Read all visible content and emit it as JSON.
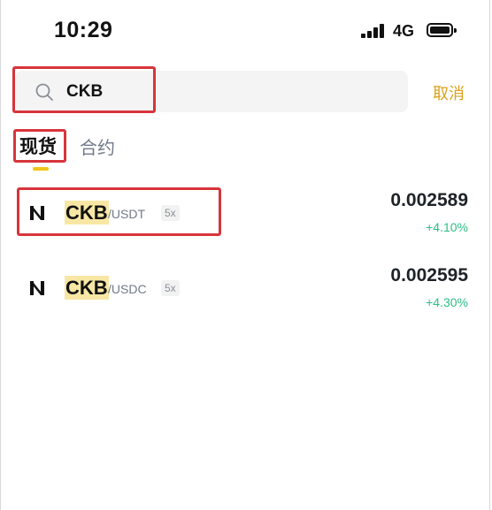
{
  "status_bar": {
    "time": "10:29",
    "network": "4G"
  },
  "search": {
    "query": "CKB",
    "cancel_label": "取消"
  },
  "tabs": [
    {
      "label": "现货",
      "active": true
    },
    {
      "label": "合约",
      "active": false
    }
  ],
  "results": [
    {
      "base": "CKB",
      "quote": "/USDT",
      "leverage": "5x",
      "price": "0.002589",
      "change": "+4.10%"
    },
    {
      "base": "CKB",
      "quote": "/USDC",
      "leverage": "5x",
      "price": "0.002595",
      "change": "+4.30%"
    }
  ],
  "colors": {
    "accent": "#f0c419",
    "cancel_text": "#d9a21b",
    "positive": "#2ebd85",
    "annotation_box": "#d8343b",
    "highlight_bg": "#f8e7a4"
  },
  "icons": {
    "search": "search-icon",
    "coin_logo": "nervos-logo-icon",
    "signal": "cellular-signal-icon",
    "battery": "battery-icon"
  }
}
